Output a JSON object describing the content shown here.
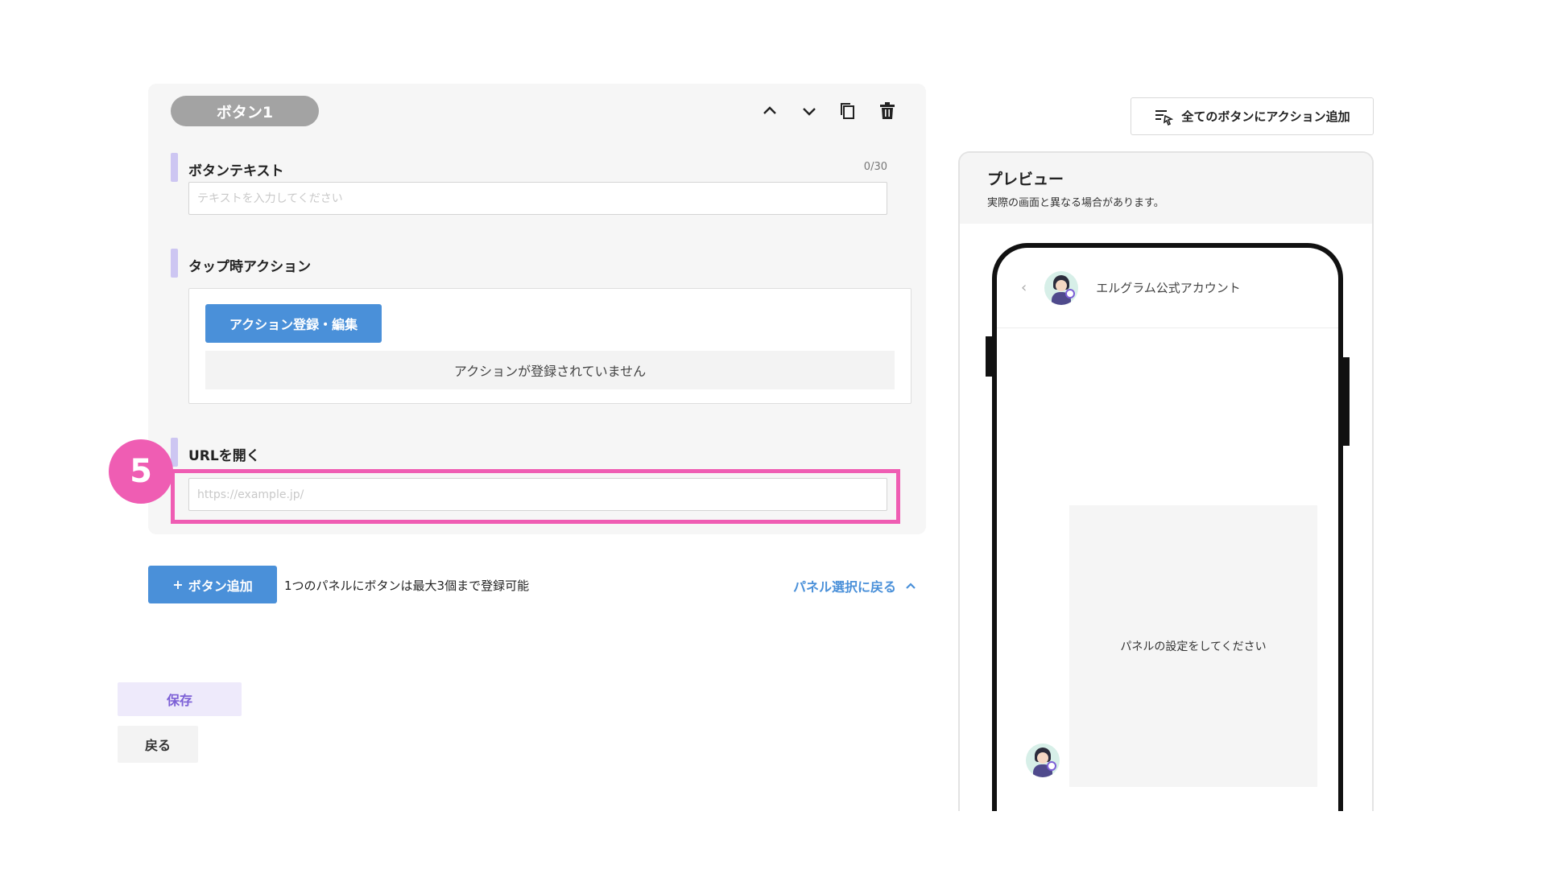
{
  "panel": {
    "pill_label": "ボタン1",
    "icons": [
      "chevron-up-icon",
      "chevron-down-icon",
      "copy-icon",
      "trash-icon"
    ],
    "button_text": {
      "label": "ボタンテキスト",
      "counter": "0/30",
      "placeholder": "テキストを入力してください",
      "value": ""
    },
    "tap_action": {
      "label": "タップ時アクション",
      "button_label": "アクション登録・編集",
      "empty_text": "アクションが登録されていません"
    },
    "url": {
      "label": "URLを開く",
      "placeholder": "https://example.jp/",
      "value": ""
    }
  },
  "annotation": {
    "step_number": "5",
    "color": "#ef5db3"
  },
  "bottom": {
    "add_button_label": "ボタン追加",
    "add_button_plus": "+",
    "limit_note": "1つのパネルにボタンは最大3個まで登録可能",
    "back_link": "パネル選択に戻る"
  },
  "footer": {
    "save_label": "保存",
    "return_label": "戻る"
  },
  "preview": {
    "all_actions_label": "全てのボタンにアクション追加",
    "title": "プレビュー",
    "note": "実際の画面と異なる場合があります。",
    "account_name": "エルグラム公式アカウント",
    "panel_placeholder": "パネルの設定をしてください"
  },
  "colors": {
    "accent_blue": "#4a90d9",
    "label_bar": "#cdc6f2",
    "save_text": "#7c5fd6",
    "pill": "#a3a3a3"
  }
}
